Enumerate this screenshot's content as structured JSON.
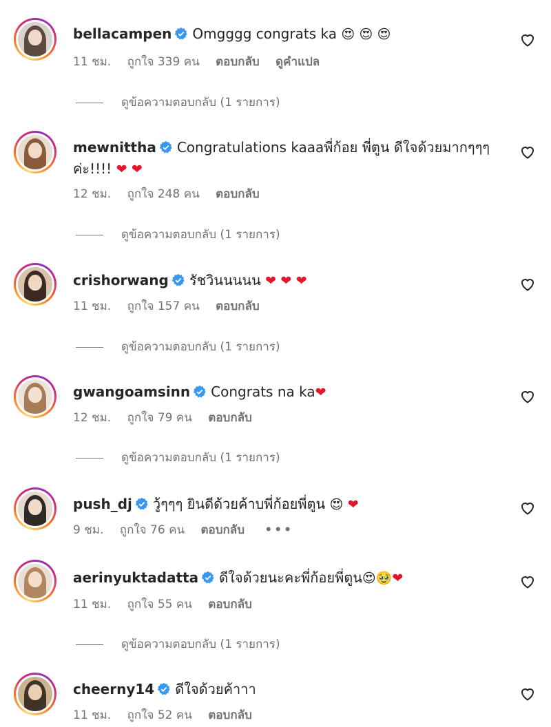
{
  "comments": [
    {
      "username": "bellacampen",
      "text": "Omgggg congrats ka",
      "emojis": [
        "😍",
        "😍",
        "😍"
      ],
      "time": "11 ชม.",
      "likes": "ถูกใจ 339 คน",
      "reply": "ตอบกลับ",
      "translate": "ดูคำแปล",
      "view_replies": "ดูข้อความตอบกลับ (1 รายการ)"
    },
    {
      "username": "mewnittha",
      "text": "Congratulations kaaaพี่ก้อย พี่ตูน ดีใจด้วยมากๆๆๆ",
      "text2": "ค่ะ!!!!",
      "emojis": [
        "❤",
        "❤"
      ],
      "time": "12 ชม.",
      "likes": "ถูกใจ 248 คน",
      "reply": "ตอบกลับ",
      "view_replies": "ดูข้อความตอบกลับ (1 รายการ)"
    },
    {
      "username": "crishorwang",
      "text": "รัชวินนนนน",
      "emojis": [
        "❤",
        "❤",
        "❤"
      ],
      "time": "11 ชม.",
      "likes": "ถูกใจ 157 คน",
      "reply": "ตอบกลับ",
      "view_replies": "ดูข้อความตอบกลับ (1 รายการ)"
    },
    {
      "username": "gwangoamsinn",
      "text": "Congrats na ka",
      "emojis": [
        "❤"
      ],
      "time": "12 ชม.",
      "likes": "ถูกใจ 79 คน",
      "reply": "ตอบกลับ",
      "view_replies": "ดูข้อความตอบกลับ (1 รายการ)"
    },
    {
      "username": "push_dj",
      "text": "วู้ๆๆๆ ยินดีด้วยค้าบพี่ก้อยพี่ตูน",
      "emojis": [
        "😍",
        "❤"
      ],
      "time": "9 ชม.",
      "likes": "ถูกใจ 76 คน",
      "reply": "ตอบกลับ",
      "more": "•••"
    },
    {
      "username": "aerinyuktadatta",
      "text": "ดีใจด้วยนะคะพี่ก้อยพี่ตูน",
      "emojis": [
        "😍",
        "🥹",
        "❤"
      ],
      "time": "11 ชม.",
      "likes": "ถูกใจ 55 คน",
      "reply": "ตอบกลับ",
      "view_replies": "ดูข้อความตอบกลับ (1 รายการ)"
    },
    {
      "username": "cheerny14",
      "text": "ดีใจด้วยค้าาา",
      "time": "11 ชม.",
      "likes": "ถูกใจ 52 คน",
      "reply": "ตอบกลับ"
    }
  ],
  "icons": {
    "verified": "verified-badge-icon",
    "like": "heart-outline-icon"
  },
  "colors": {
    "verified": "#3897f0",
    "muted": "#737373",
    "heart": "#e3162b"
  }
}
